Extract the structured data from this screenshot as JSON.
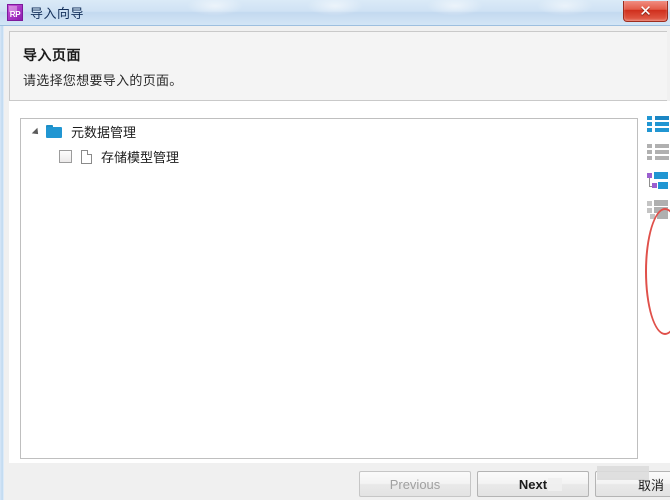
{
  "window": {
    "title": "导入向导",
    "app_icon": "rp-icon",
    "app_icon_text": "RP",
    "close_label": "✕",
    "title_bar_color": "#cfe2f4",
    "accent_color": "#2196d2",
    "annotation_color": "#e0504a"
  },
  "header": {
    "title": "导入页面",
    "subtitle": "请选择您想要导入的页面。"
  },
  "tree": {
    "nodes": [
      {
        "label": "元数据管理",
        "icon": "folder-icon",
        "expanded": true,
        "has_checkbox": false,
        "level": 0
      },
      {
        "label": "存储模型管理",
        "icon": "page-icon",
        "expanded": false,
        "has_checkbox": true,
        "checked": false,
        "level": 1
      }
    ]
  },
  "side_tools": [
    {
      "name": "select-all-icon",
      "state": "enabled",
      "color": "#2196d2"
    },
    {
      "name": "deselect-all-icon",
      "state": "disabled",
      "color": "#b0b0b0"
    },
    {
      "name": "expand-all-icon",
      "state": "enabled",
      "color": "#2196d2"
    },
    {
      "name": "collapse-all-icon",
      "state": "disabled",
      "color": "#b0b0b0"
    }
  ],
  "footer": {
    "previous_label": "Previous",
    "previous_disabled": true,
    "next_label": "Next",
    "cancel_label": "取消"
  }
}
